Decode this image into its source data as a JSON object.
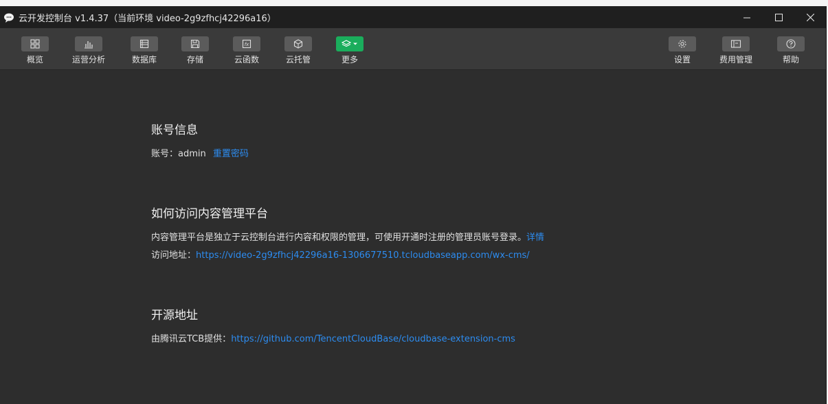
{
  "window": {
    "title": "云开发控制台 v1.4.37（当前环境 video-2g9zfhcj42296a16）"
  },
  "toolbar": {
    "left": [
      {
        "label": "概览",
        "icon": "grid-icon"
      },
      {
        "label": "运营分析",
        "icon": "bar-chart-icon"
      },
      {
        "label": "数据库",
        "icon": "database-icon"
      },
      {
        "label": "存储",
        "icon": "save-icon"
      },
      {
        "label": "云函数",
        "icon": "function-icon"
      },
      {
        "label": "云托管",
        "icon": "cube-icon"
      },
      {
        "label": "更多",
        "icon": "layers-dropdown-icon"
      }
    ],
    "right": [
      {
        "label": "设置",
        "icon": "gear-icon"
      },
      {
        "label": "费用管理",
        "icon": "billing-icon"
      },
      {
        "label": "帮助",
        "icon": "help-icon"
      }
    ]
  },
  "account": {
    "heading": "账号信息",
    "label": "账号：",
    "username": "admin",
    "reset_link": "重置密码"
  },
  "cms": {
    "heading": "如何访问内容管理平台",
    "description": "内容管理平台是独立于云控制台进行内容和权限的管理，可使用开通时注册的管理员账号登录。",
    "details_link": "详情",
    "url_label": "访问地址：",
    "url": "https://video-2g9zfhcj42296a16-1306677510.tcloudbaseapp.com/wx-cms/"
  },
  "opensource": {
    "heading": "开源地址",
    "label": "由腾讯云TCB提供：",
    "url": "https://github.com/TencentCloudBase/cloudbase-extension-cms"
  },
  "colors": {
    "link": "#2d8cf0",
    "accent_green": "#1aad5c",
    "background": "#2d2d2d"
  }
}
